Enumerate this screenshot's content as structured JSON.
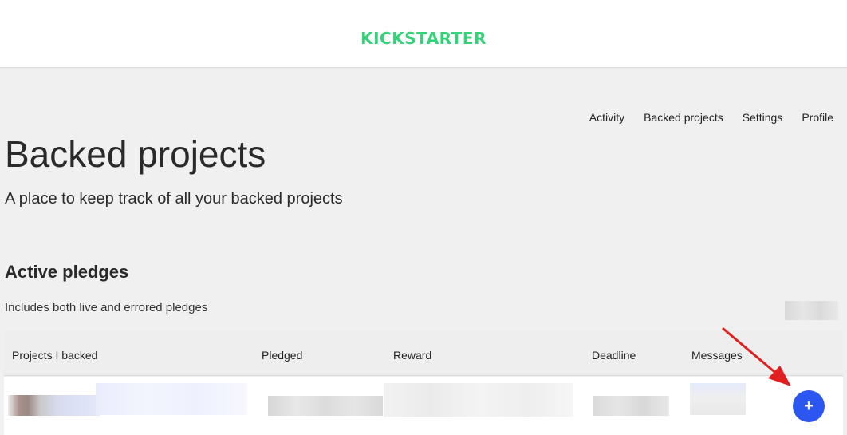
{
  "header": {
    "logo_text": "KICKSTARTER",
    "logo_color": "#36d27a"
  },
  "nav": {
    "items": [
      {
        "label": "Activity"
      },
      {
        "label": "Backed projects"
      },
      {
        "label": "Settings"
      },
      {
        "label": "Profile"
      }
    ]
  },
  "page": {
    "title": "Backed projects",
    "subtitle": "A place to keep track of all your backed projects"
  },
  "pledges": {
    "section_title": "Active pledges",
    "section_desc": "Includes both live and errored pledges",
    "columns": [
      "Projects I backed",
      "Pledged",
      "Reward",
      "Deadline",
      "Messages"
    ],
    "add_button_label": "+",
    "add_button_color": "#2b56f0",
    "arrow_color": "#e02020"
  }
}
